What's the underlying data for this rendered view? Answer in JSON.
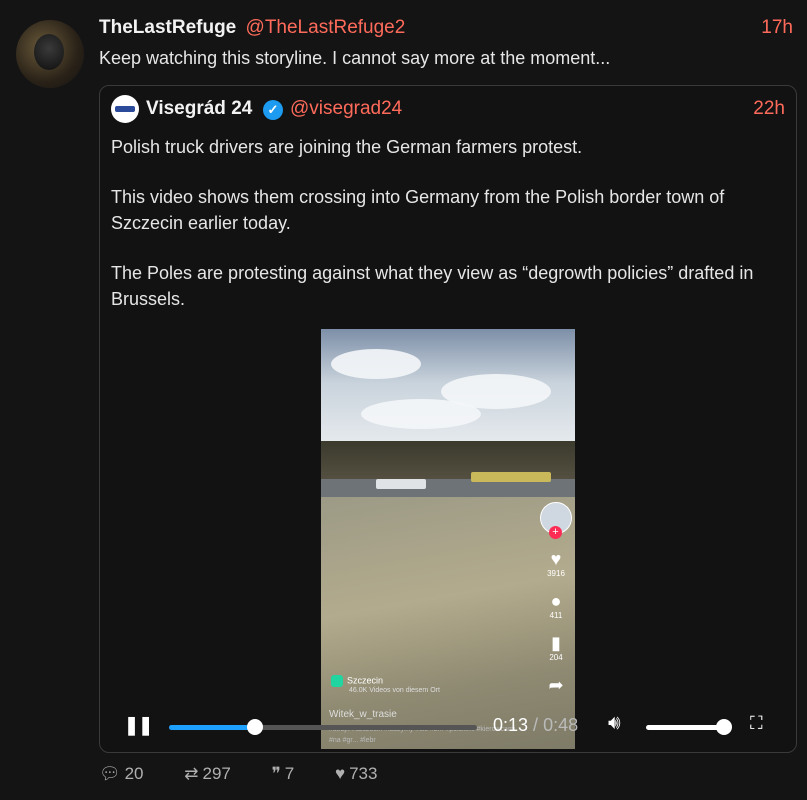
{
  "tweet": {
    "author_name": "TheLastRefuge",
    "handle": "@TheLastRefuge2",
    "time": "17h",
    "text": "Keep watching this storyline.  I cannot say more at the moment..."
  },
  "quote": {
    "author_name": "Visegrád 24",
    "verified_icon": "verified-badge-icon",
    "handle": "@visegrad24",
    "time": "22h",
    "paragraphs": [
      "Polish truck drivers are joining the German farmers protest.",
      "This video shows them crossing into Germany from the Polish border town of Szczecin earlier today.",
      "The Poles are protesting against what they view as “degrowth policies” drafted in Brussels."
    ]
  },
  "video": {
    "sidebar_counts": {
      "likes": "3916",
      "comments": "411",
      "saves": "204"
    },
    "location": "Szczecin",
    "location_sub": "46.0K Videos von diesem Ort",
    "author": "Witek_w_trasie",
    "tags": "#strajk #szczecin #łaczymy #sie #z... #polskimi #kierowcami #na #gr... #lebr",
    "controls": {
      "current_time": "0:13",
      "separator": " / ",
      "duration": "0:48",
      "progress": 0.28,
      "volume": 1.0
    }
  },
  "actions": {
    "replies": "20",
    "retweets": "297",
    "quotes": "7",
    "likes": "733"
  },
  "colors": {
    "accent": "#ff6b5b",
    "progress": "#1ea0ff",
    "verified": "#1d9bf0"
  }
}
